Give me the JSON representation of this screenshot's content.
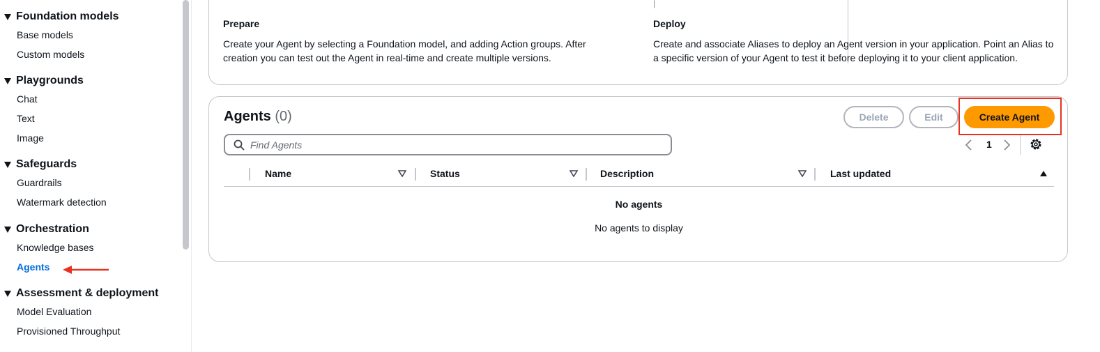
{
  "sidebar": {
    "sections": [
      {
        "header": "Foundation models",
        "items": [
          "Base models",
          "Custom models"
        ]
      },
      {
        "header": "Playgrounds",
        "items": [
          "Chat",
          "Text",
          "Image"
        ]
      },
      {
        "header": "Safeguards",
        "items": [
          "Guardrails",
          "Watermark detection"
        ]
      },
      {
        "header": "Orchestration",
        "items": [
          "Knowledge bases",
          "Agents"
        ]
      },
      {
        "header": "Assessment & deployment",
        "items": [
          "Model Evaluation",
          "Provisioned Throughput"
        ]
      }
    ],
    "active_item": "Agents"
  },
  "overview": {
    "prepare": {
      "title": "Prepare",
      "text": "Create your Agent by selecting a Foundation model, and adding Action groups. After creation you can test out the Agent in real-time and create multiple versions."
    },
    "deploy": {
      "title": "Deploy",
      "text": "Create and associate Aliases to deploy an Agent version in your application. Point an Alias to a specific version of your Agent to test it before deploying it to your client application."
    }
  },
  "agents": {
    "title": "Agents",
    "count": "(0)",
    "buttons": {
      "delete": "Delete",
      "edit": "Edit",
      "create": "Create Agent"
    },
    "search_placeholder": "Find Agents",
    "pagination": {
      "current_page": "1"
    },
    "columns": [
      "Name",
      "Status",
      "Description",
      "Last updated"
    ],
    "empty": {
      "title": "No agents",
      "subtitle": "No agents to display"
    }
  },
  "colors": {
    "accent": "#006ce0",
    "primary_button": "#ff9900",
    "annotation_red": "#e8321f"
  }
}
